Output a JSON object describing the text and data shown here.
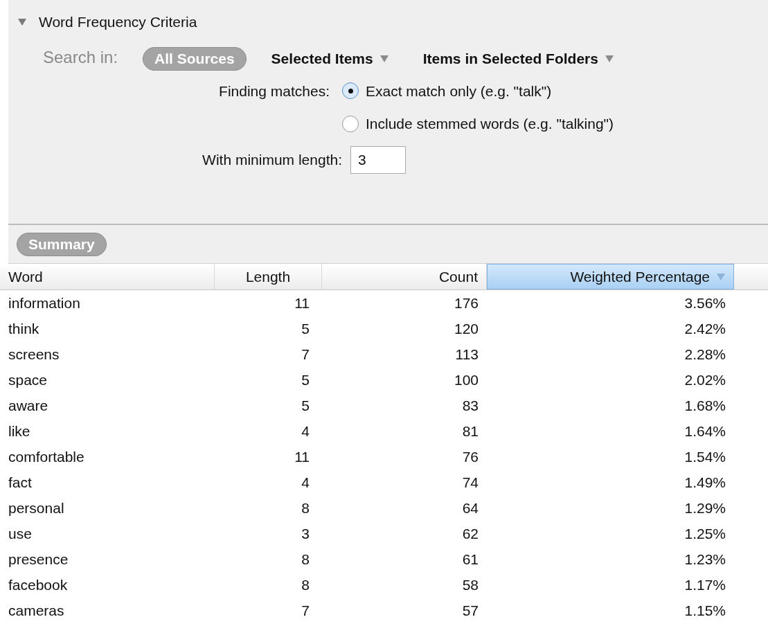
{
  "criteria": {
    "title": "Word Frequency Criteria",
    "expanded": true,
    "search_label": "Search in:",
    "scopes": [
      {
        "label": "All Sources",
        "kind": "pill",
        "selected": true
      },
      {
        "label": "Selected Items",
        "kind": "menu",
        "selected": false
      },
      {
        "label": "Items in Selected Folders",
        "kind": "menu",
        "selected": false
      }
    ],
    "matches_label": "Finding matches:",
    "match_options": [
      {
        "label": "Exact match only (e.g. \"talk\")",
        "selected": true
      },
      {
        "label": "Include stemmed words (e.g. \"talking\")",
        "selected": false
      }
    ],
    "min_length_label": "With minimum length:",
    "min_length_value": "3"
  },
  "summary_button": "Summary",
  "table": {
    "columns": [
      {
        "label": "Word",
        "sorted": false
      },
      {
        "label": "Length",
        "sorted": false
      },
      {
        "label": "Count",
        "sorted": false
      },
      {
        "label": "Weighted Percentage",
        "sorted": true
      }
    ],
    "rows": [
      [
        "information",
        "11",
        "176",
        "3.56%"
      ],
      [
        "think",
        "5",
        "120",
        "2.42%"
      ],
      [
        "screens",
        "7",
        "113",
        "2.28%"
      ],
      [
        "space",
        "5",
        "100",
        "2.02%"
      ],
      [
        "aware",
        "5",
        "83",
        "1.68%"
      ],
      [
        "like",
        "4",
        "81",
        "1.64%"
      ],
      [
        "comfortable",
        "11",
        "76",
        "1.54%"
      ],
      [
        "fact",
        "4",
        "74",
        "1.49%"
      ],
      [
        "personal",
        "8",
        "64",
        "1.29%"
      ],
      [
        "use",
        "3",
        "62",
        "1.25%"
      ],
      [
        "presence",
        "8",
        "61",
        "1.23%"
      ],
      [
        "facebook",
        "8",
        "58",
        "1.17%"
      ],
      [
        "cameras",
        "7",
        "57",
        "1.15%"
      ]
    ]
  }
}
